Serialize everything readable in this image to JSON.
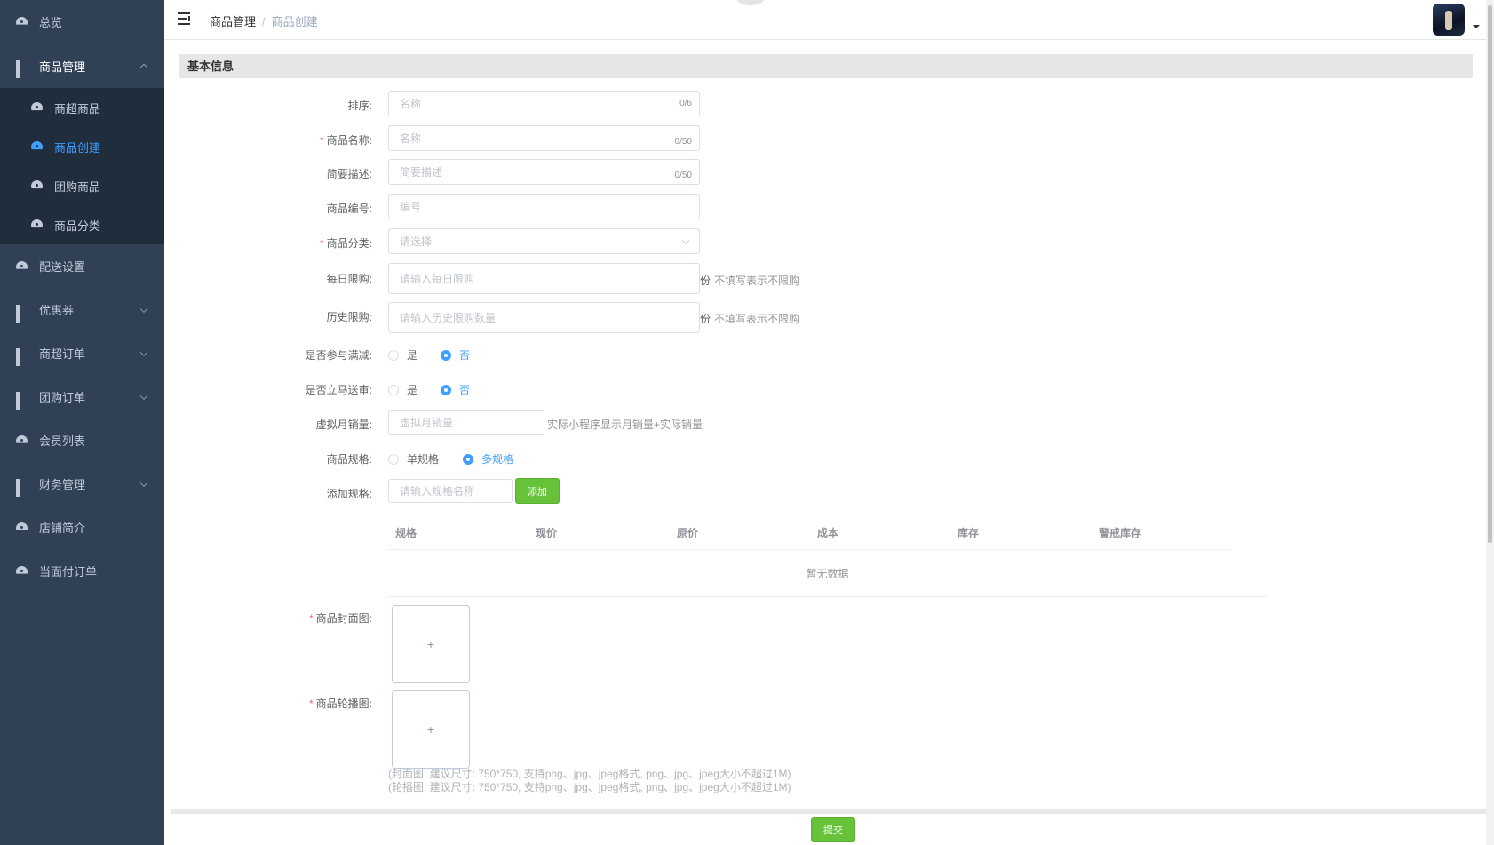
{
  "sidebar": {
    "items": [
      {
        "label": "总览",
        "icon": "gauge-icon"
      },
      {
        "label": "商品管理",
        "icon": "grid-icon",
        "expanded": true,
        "children": [
          {
            "label": "商超商品",
            "icon": "gauge-icon"
          },
          {
            "label": "商品创建",
            "icon": "gauge-icon",
            "active": true
          },
          {
            "label": "团购商品",
            "icon": "gauge-icon"
          },
          {
            "label": "商品分类",
            "icon": "gauge-icon"
          }
        ]
      },
      {
        "label": "配送设置",
        "icon": "gauge-icon"
      },
      {
        "label": "优惠券",
        "icon": "grid-icon"
      },
      {
        "label": "商超订单",
        "icon": "grid-icon"
      },
      {
        "label": "团购订单",
        "icon": "grid-icon"
      },
      {
        "label": "会员列表",
        "icon": "gauge-icon"
      },
      {
        "label": "财务管理",
        "icon": "grid-icon"
      },
      {
        "label": "店铺简介",
        "icon": "gauge-icon"
      },
      {
        "label": "当面付订单",
        "icon": "gauge-icon"
      }
    ]
  },
  "header": {
    "breadcrumb": [
      "商品管理",
      "商品创建"
    ],
    "separator": "/"
  },
  "form": {
    "section_title": "基本信息",
    "sort": {
      "label": "排序:",
      "placeholder": "名称",
      "counter": "0/6"
    },
    "name": {
      "label": "商品名称:",
      "placeholder": "名称",
      "counter": "0/50",
      "required": true
    },
    "desc": {
      "label": "简要描述:",
      "placeholder": "简要描述",
      "counter": "0/50"
    },
    "code": {
      "label": "商品编号:",
      "placeholder": "编号"
    },
    "category": {
      "label": "商品分类:",
      "placeholder": "请选择",
      "required": true
    },
    "daily_limit": {
      "label": "每日限购:",
      "placeholder": "请输入每日限购",
      "unit": "份",
      "hint": "不填写表示不限购"
    },
    "history_limit": {
      "label": "历史限购:",
      "placeholder": "请输入历史限购数量",
      "unit": "份",
      "hint": "不填写表示不限购"
    },
    "full_reduction": {
      "label": "是否参与满减:",
      "yes": "是",
      "no": "否",
      "selected": "否"
    },
    "instant_delivery": {
      "label": "是否立马送审:",
      "yes": "是",
      "no": "否",
      "selected": "否"
    },
    "virtual_sales": {
      "label": "虚拟月销量:",
      "placeholder": "虚拟月销量",
      "hint": "实际小程序显示月销量+实际销量"
    },
    "spec_type": {
      "label": "商品规格:",
      "single": "单规格",
      "multi": "多规格",
      "selected": "多规格"
    },
    "add_spec": {
      "label": "添加规格:",
      "placeholder": "请输入规格名称",
      "button": "添加"
    },
    "spec_table": {
      "columns": [
        "规格",
        "现价",
        "原价",
        "成本",
        "库存",
        "警戒库存"
      ],
      "empty_text": "暂无数据"
    },
    "cover": {
      "label": "商品封面图:",
      "required": true,
      "plus": "+"
    },
    "carousel": {
      "label": "商品轮播图:",
      "required": true,
      "plus": "+"
    },
    "notes": [
      "(封面图: 建议尺寸: 750*750, 支持png、jpg、jpeg格式, png、jpg、jpeg大小不超过1M)",
      "(轮播图: 建议尺寸: 750*750, 支持png、jpg、jpeg格式, png、jpg、jpeg大小不超过1M)"
    ],
    "submit": "提交"
  },
  "colors": {
    "sidebar_bg": "#304156",
    "submenu_bg": "#1f2d3d",
    "accent": "#409eff",
    "success": "#67c23a",
    "required": "#f56c6c"
  }
}
